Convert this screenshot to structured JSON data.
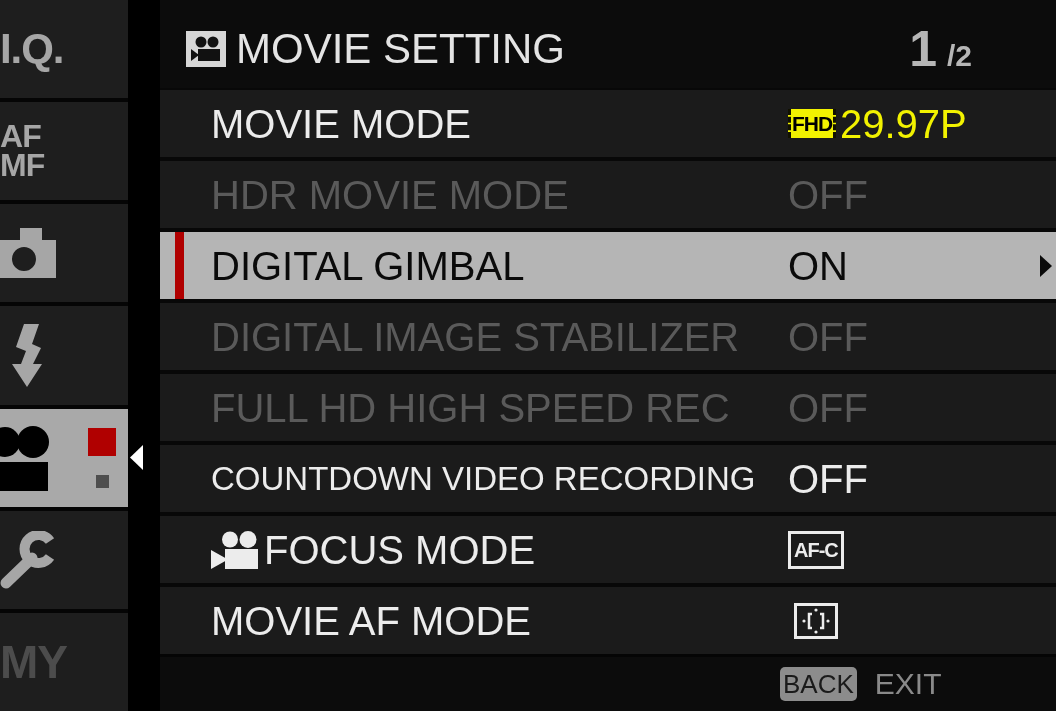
{
  "sidebar": {
    "tabs": [
      {
        "kind": "text",
        "label": "I.Q.",
        "selected": false,
        "disabled": false
      },
      {
        "kind": "text",
        "label": "AF MF",
        "selected": false,
        "disabled": false
      },
      {
        "kind": "camera",
        "selected": false,
        "disabled": false
      },
      {
        "kind": "flash",
        "selected": false,
        "disabled": false
      },
      {
        "kind": "movie",
        "selected": true,
        "disabled": false,
        "page_markers": [
          {
            "selected": true
          },
          {
            "selected": false
          }
        ]
      },
      {
        "kind": "wrench",
        "selected": false,
        "disabled": false
      },
      {
        "kind": "text",
        "label": "MY",
        "selected": false,
        "disabled": true
      }
    ]
  },
  "header": {
    "title": "MOVIE SETTING",
    "page": {
      "current": "1",
      "total": "/2"
    }
  },
  "rows": [
    {
      "kind": "plain",
      "label": "MOVIE MODE",
      "value": {
        "kind": "format",
        "badge": "FHD",
        "text": "29.97P"
      },
      "selected": false,
      "disabled": false
    },
    {
      "kind": "plain",
      "label": "HDR MOVIE MODE",
      "value": {
        "kind": "text",
        "text": "OFF"
      },
      "selected": false,
      "disabled": true
    },
    {
      "kind": "plain",
      "label": "DIGITAL GIMBAL",
      "value": {
        "kind": "text",
        "text": "ON"
      },
      "selected": true,
      "disabled": false
    },
    {
      "kind": "plain",
      "label": "DIGITAL IMAGE STABILIZER",
      "value": {
        "kind": "text",
        "text": "OFF"
      },
      "selected": false,
      "disabled": true
    },
    {
      "kind": "plain",
      "label": "FULL HD HIGH SPEED REC",
      "value": {
        "kind": "text",
        "text": "OFF"
      },
      "selected": false,
      "disabled": true
    },
    {
      "kind": "plain",
      "label": "COUNTDOWN VIDEO RECORDING",
      "value": {
        "kind": "text",
        "text": "OFF"
      },
      "selected": false,
      "disabled": false
    },
    {
      "kind": "movie",
      "label": "FOCUS MODE",
      "value": {
        "kind": "boxed",
        "text": "AF-C"
      },
      "selected": false,
      "disabled": false
    },
    {
      "kind": "plain",
      "label": "MOVIE AF MODE",
      "value": {
        "kind": "icon"
      },
      "selected": false,
      "disabled": false
    }
  ],
  "footer": {
    "key": "BACK",
    "action": "EXIT"
  }
}
